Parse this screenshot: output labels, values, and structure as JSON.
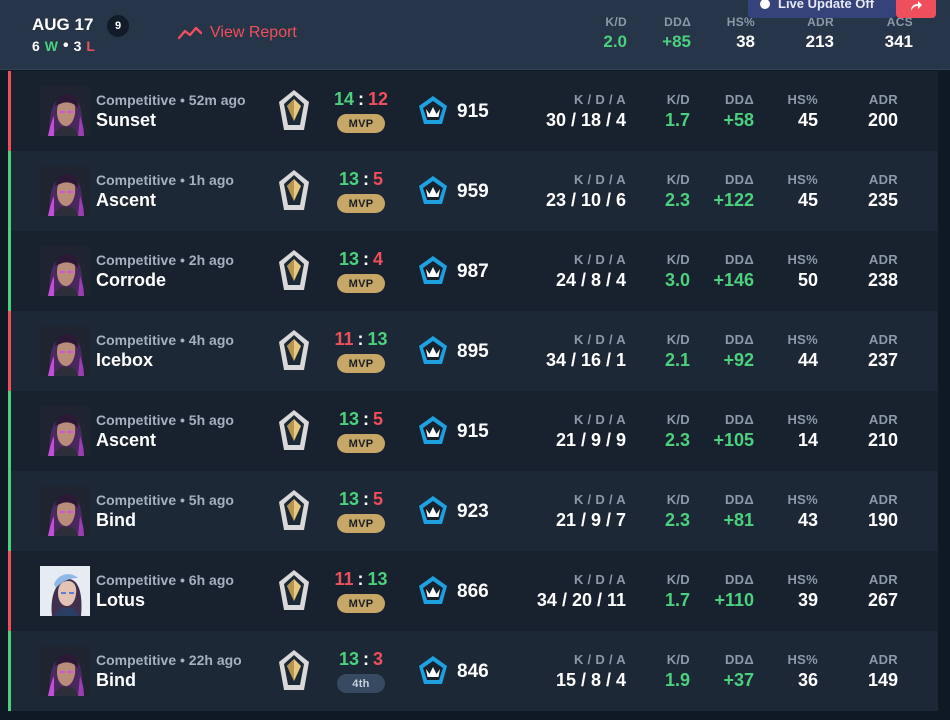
{
  "header": {
    "date": "AUG 17",
    "match_count": "9",
    "wins": "6",
    "wins_letter": "W",
    "losses": "3",
    "losses_letter": "L",
    "view_report": "View Report",
    "live_label": "Live Update Off",
    "stats": [
      {
        "label": "K/D",
        "value": "2.0"
      },
      {
        "label": "DDΔ",
        "value": "+85"
      },
      {
        "label": "HS%",
        "value": "38"
      },
      {
        "label": "ADR",
        "value": "213"
      },
      {
        "label": "ACS",
        "value": "341"
      }
    ]
  },
  "labels": {
    "kda": "K / D / A",
    "kd": "K/D",
    "dd": "DDΔ",
    "hs": "HS%",
    "adr": "ADR"
  },
  "colors": {
    "win": "#4cd07d",
    "loss": "#ef4f5c",
    "mvp": "#c7a767",
    "header_bg": "#263548",
    "row_bg": "#17222e"
  },
  "matches": [
    {
      "result": "loss",
      "agent": "reyna",
      "mode": "Competitive • 52m ago",
      "map": "Sunset",
      "score_left": "14",
      "score_right": "12",
      "badge": "MVP",
      "acs": "915",
      "kda": "30 / 18 / 4",
      "kd": "1.7",
      "dd": "+58",
      "hs": "45",
      "adr": "200"
    },
    {
      "result": "win",
      "agent": "reyna",
      "mode": "Competitive • 1h ago",
      "map": "Ascent",
      "score_left": "13",
      "score_right": "5",
      "badge": "MVP",
      "acs": "959",
      "kda": "23 / 10 / 6",
      "kd": "2.3",
      "dd": "+122",
      "hs": "45",
      "adr": "235"
    },
    {
      "result": "win",
      "agent": "reyna",
      "mode": "Competitive • 2h ago",
      "map": "Corrode",
      "score_left": "13",
      "score_right": "4",
      "badge": "MVP",
      "acs": "987",
      "kda": "24 / 8 / 4",
      "kd": "3.0",
      "dd": "+146",
      "hs": "50",
      "adr": "238"
    },
    {
      "result": "loss",
      "agent": "reyna",
      "mode": "Competitive • 4h ago",
      "map": "Icebox",
      "score_left": "11",
      "score_right": "13",
      "badge": "MVP",
      "acs": "895",
      "kda": "34 / 16 / 1",
      "kd": "2.1",
      "dd": "+92",
      "hs": "44",
      "adr": "237"
    },
    {
      "result": "win",
      "agent": "reyna",
      "mode": "Competitive • 5h ago",
      "map": "Ascent",
      "score_left": "13",
      "score_right": "5",
      "badge": "MVP",
      "acs": "915",
      "kda": "21 / 9 / 9",
      "kd": "2.3",
      "dd": "+105",
      "hs": "14",
      "adr": "210"
    },
    {
      "result": "win",
      "agent": "reyna",
      "mode": "Competitive • 5h ago",
      "map": "Bind",
      "score_left": "13",
      "score_right": "5",
      "badge": "MVP",
      "acs": "923",
      "kda": "21 / 9 / 7",
      "kd": "2.3",
      "dd": "+81",
      "hs": "43",
      "adr": "190"
    },
    {
      "result": "loss",
      "agent": "clove",
      "mode": "Competitive • 6h ago",
      "map": "Lotus",
      "score_left": "11",
      "score_right": "13",
      "badge": "MVP",
      "acs": "866",
      "kda": "34 / 20 / 11",
      "kd": "1.7",
      "dd": "+110",
      "hs": "39",
      "adr": "267"
    },
    {
      "result": "win",
      "agent": "reyna",
      "mode": "Competitive • 22h ago",
      "map": "Bind",
      "score_left": "13",
      "score_right": "3",
      "badge": "4th",
      "acs": "846",
      "kda": "15 / 8 / 4",
      "kd": "1.9",
      "dd": "+37",
      "hs": "36",
      "adr": "149"
    }
  ]
}
